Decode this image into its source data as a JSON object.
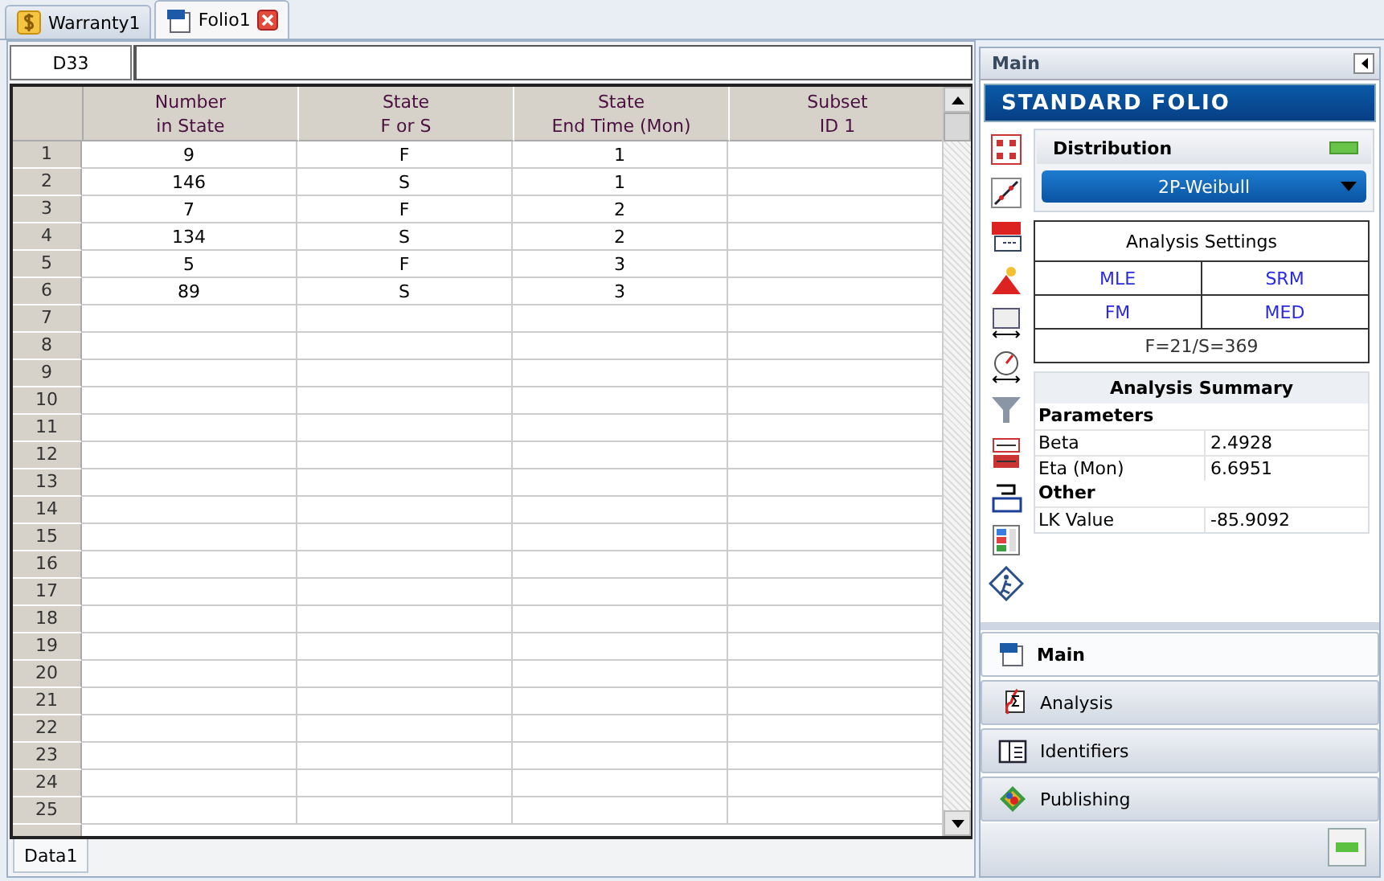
{
  "tabs": [
    {
      "label": "Warranty1",
      "kind": "dollar",
      "selected": false
    },
    {
      "label": "Folio1",
      "kind": "folio",
      "selected": true
    }
  ],
  "cell_reference": "D33",
  "table": {
    "columns": [
      "Number\nin State",
      "State\nF or S",
      "State\nEnd Time (Mon)",
      "Subset\nID 1"
    ],
    "rows": [
      {
        "number": "1",
        "cells": [
          "9",
          "F",
          "1",
          ""
        ]
      },
      {
        "number": "2",
        "cells": [
          "146",
          "S",
          "1",
          ""
        ]
      },
      {
        "number": "3",
        "cells": [
          "7",
          "F",
          "2",
          ""
        ]
      },
      {
        "number": "4",
        "cells": [
          "134",
          "S",
          "2",
          ""
        ]
      },
      {
        "number": "5",
        "cells": [
          "5",
          "F",
          "3",
          ""
        ]
      },
      {
        "number": "6",
        "cells": [
          "89",
          "S",
          "3",
          ""
        ]
      },
      {
        "number": "7"
      },
      {
        "number": "8"
      },
      {
        "number": "9"
      },
      {
        "number": "10"
      },
      {
        "number": "11"
      },
      {
        "number": "12"
      },
      {
        "number": "13"
      },
      {
        "number": "14"
      },
      {
        "number": "15"
      },
      {
        "number": "16"
      },
      {
        "number": "17"
      },
      {
        "number": "18"
      },
      {
        "number": "19"
      },
      {
        "number": "20"
      },
      {
        "number": "21"
      },
      {
        "number": "22"
      },
      {
        "number": "23"
      },
      {
        "number": "24"
      },
      {
        "number": "25"
      }
    ]
  },
  "sheet_tabs": [
    {
      "label": "Data1",
      "selected": true
    }
  ],
  "side_panel": {
    "title": "Main",
    "banner": "STANDARD FOLIO",
    "distribution": {
      "title": "Distribution",
      "value": "2P-Weibull"
    },
    "analysis_settings": {
      "title": "Analysis Settings",
      "options": [
        "MLE",
        "SRM",
        "FM",
        "MED"
      ],
      "counts": "F=21/S=369"
    },
    "analysis_summary": {
      "title": "Analysis Summary",
      "sections": [
        {
          "heading": "Parameters",
          "rows": [
            {
              "label": "Beta",
              "value": "2.4928"
            },
            {
              "label": "Eta (Mon)",
              "value": "6.6951"
            }
          ]
        },
        {
          "heading": "Other",
          "rows": [
            {
              "label": "LK Value",
              "value": "-85.9092"
            }
          ]
        }
      ]
    },
    "nav": [
      {
        "label": "Main",
        "kind": "folio",
        "selected": true
      },
      {
        "label": "Analysis",
        "kind": "analysis",
        "selected": false
      },
      {
        "label": "Identifiers",
        "kind": "identifiers",
        "selected": false
      },
      {
        "label": "Publishing",
        "kind": "publishing",
        "selected": false
      }
    ]
  }
}
